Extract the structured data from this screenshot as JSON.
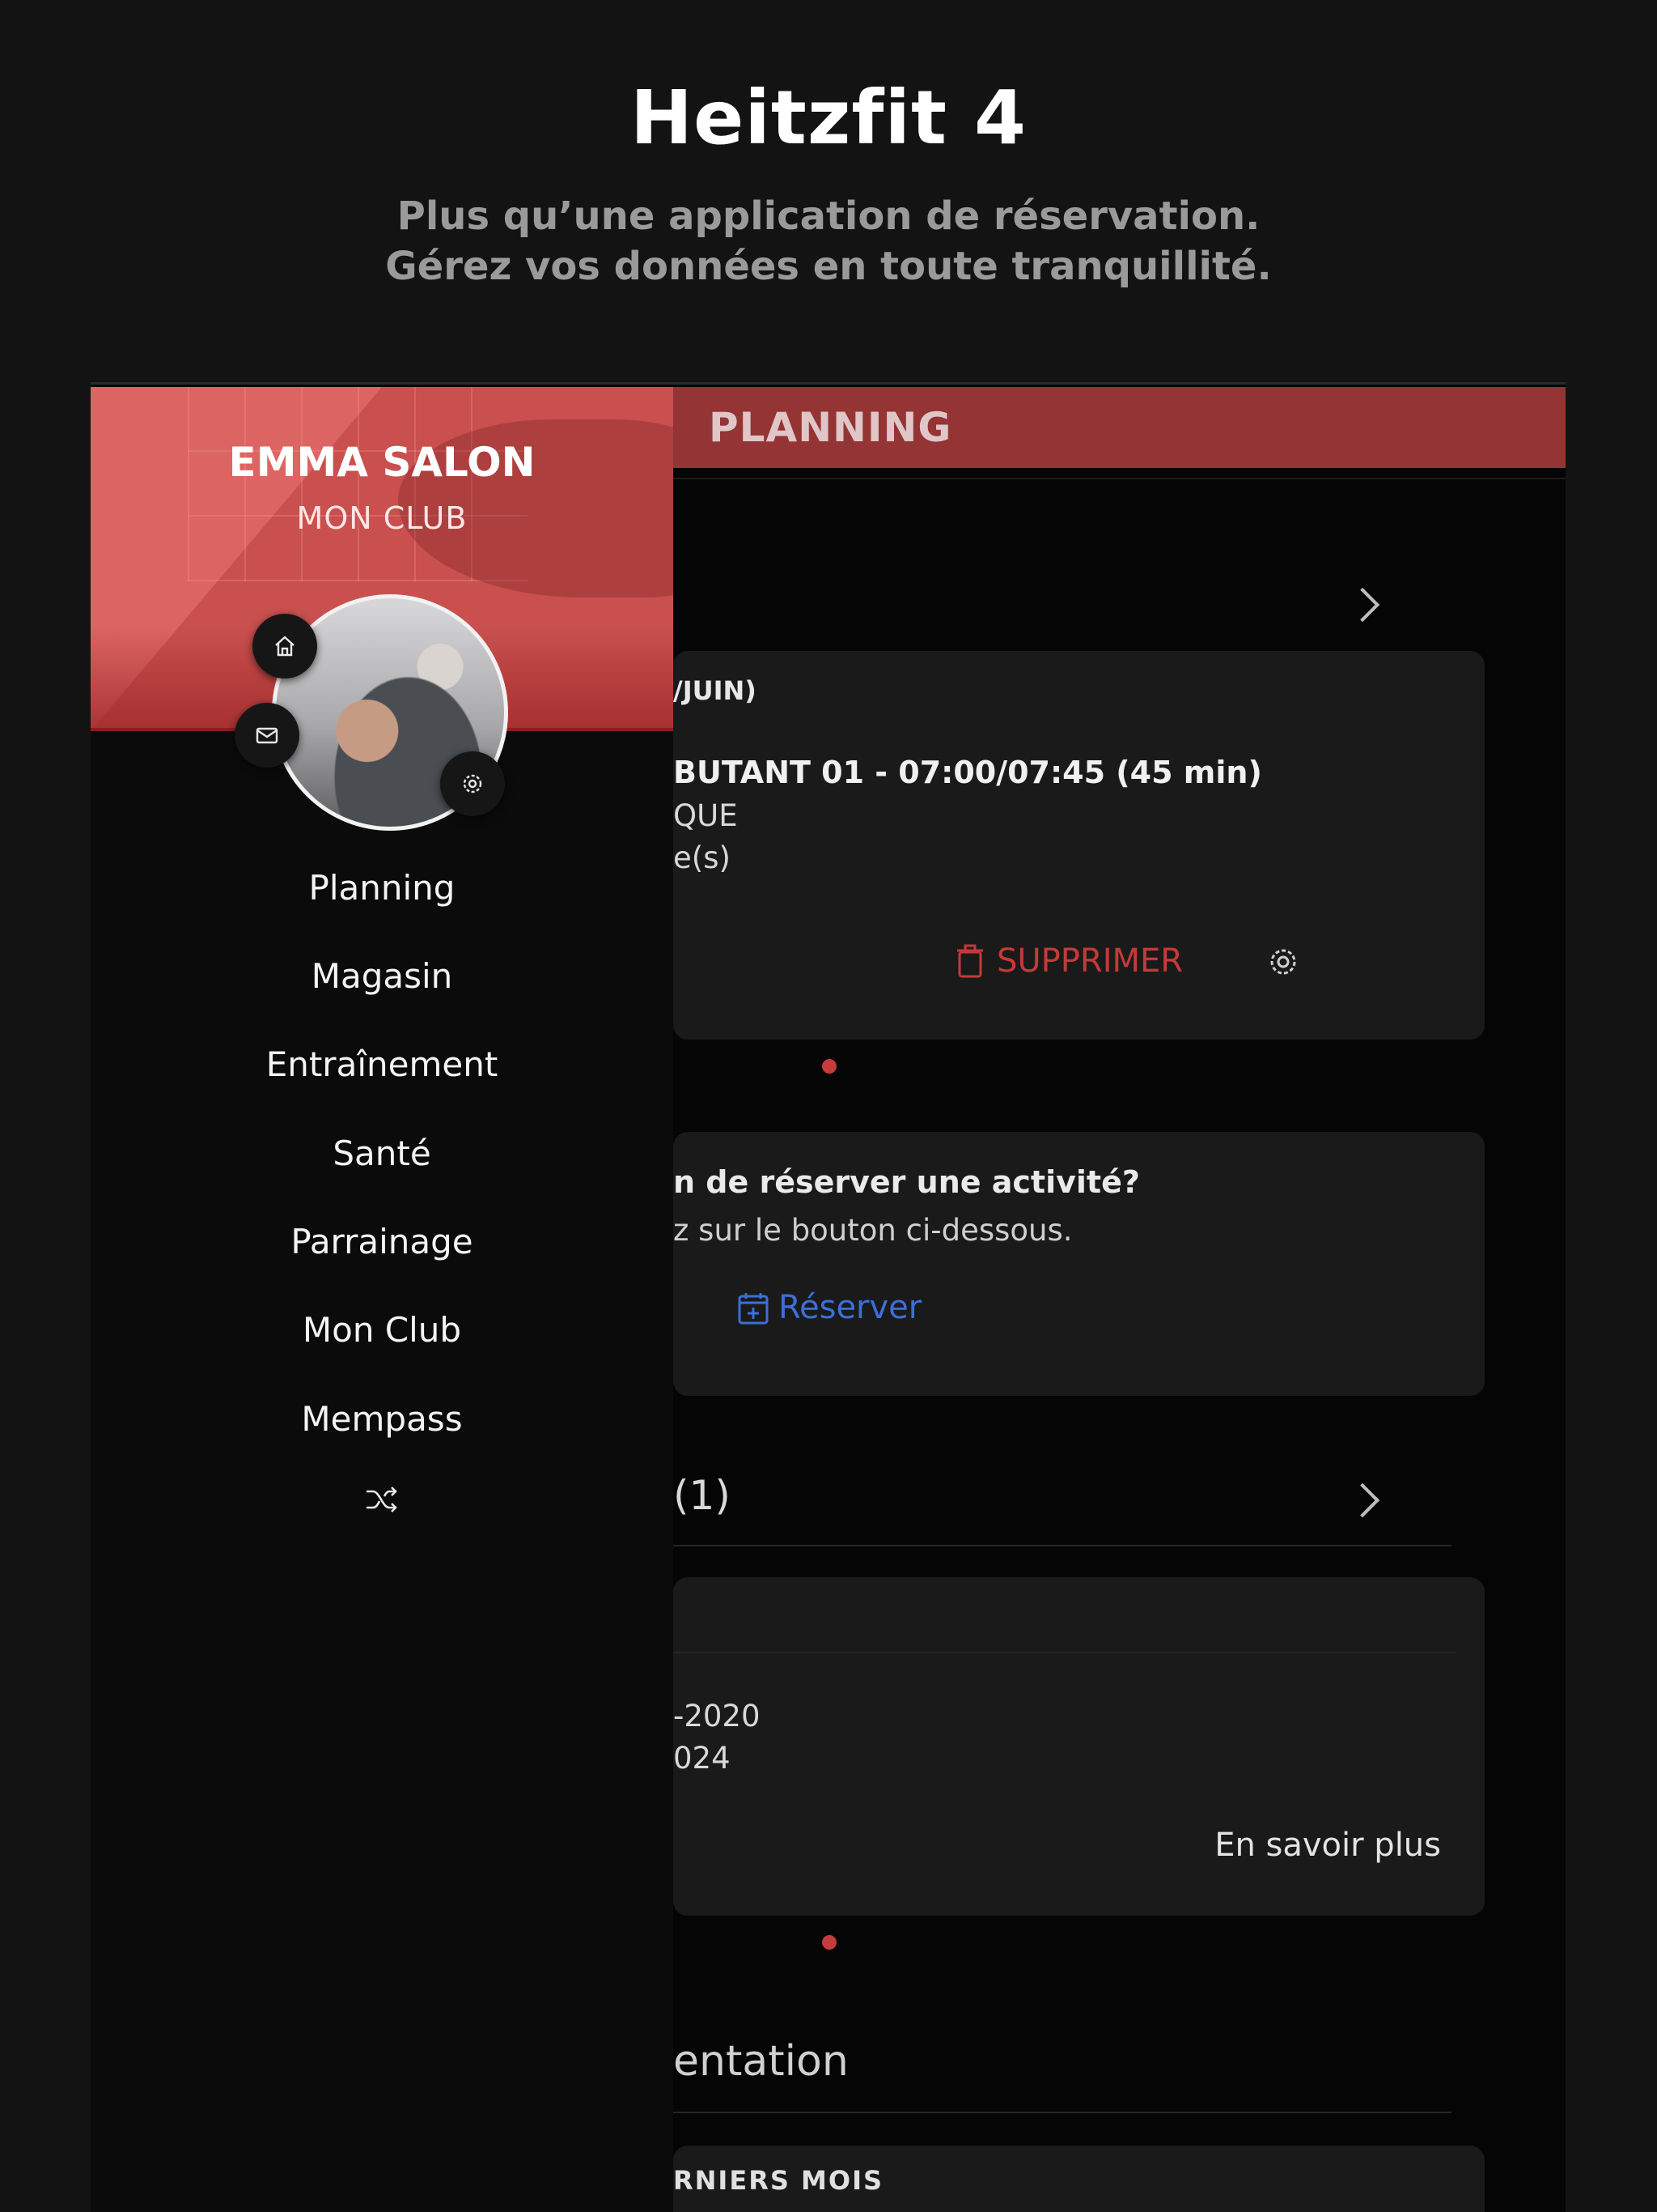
{
  "hero": {
    "title": "Heitzfit 4",
    "subtitle_line1": "Plus qu’une application de réservation.",
    "subtitle_line2": "Gérez vos données en toute tranquillité."
  },
  "header": {
    "title": "PLANNING"
  },
  "drawer": {
    "user_name": "EMMA SALON",
    "club_label": "MON CLUB",
    "menu": [
      {
        "label": "Planning"
      },
      {
        "label": "Magasin"
      },
      {
        "label": "Entraînement"
      },
      {
        "label": "Santé"
      },
      {
        "label": "Parrainage"
      },
      {
        "label": "Mon Club"
      },
      {
        "label": "Mempass"
      }
    ],
    "icons": {
      "home": "home-icon",
      "mail": "mail-icon",
      "settings": "gear-icon",
      "switch": "shuffle-icon"
    }
  },
  "booking_card": {
    "date": "/JUIN)",
    "activity": "BUTANT 01 - 07:00/07:45 (45 min)",
    "line2": "QUE",
    "line3": "e(s)",
    "delete_label": "SUPPRIMER"
  },
  "reserve_card": {
    "question": "n de réserver une activité?",
    "hint": "z sur le bouton ci-dessous.",
    "reserve_label": "Réserver"
  },
  "section2": {
    "title": "(1)"
  },
  "subscription_card": {
    "line1": "-2020",
    "line2": "024",
    "more_label": "En savoir plus"
  },
  "section3": {
    "title": "entation"
  },
  "last_card": {
    "title": "RNIERS MOIS"
  },
  "colors": {
    "background": "#131313",
    "accent_red": "#943434",
    "delete_red": "#c43a3a",
    "link_blue": "#3d6fd8",
    "drawer_header": "#c9504e"
  }
}
